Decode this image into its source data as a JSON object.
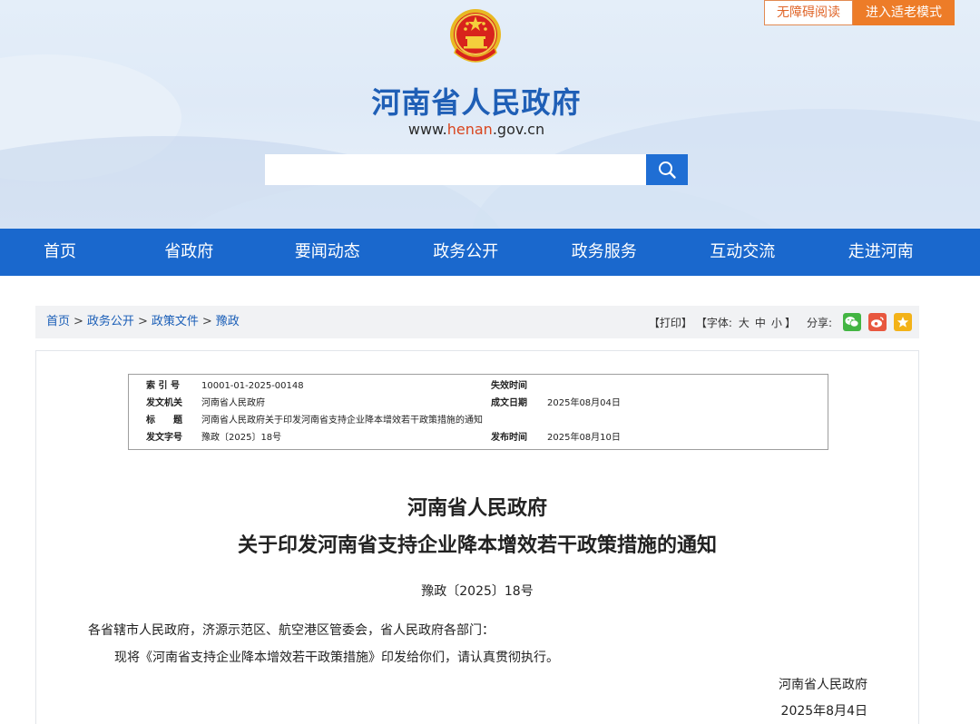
{
  "header": {
    "accessibility_label": "无障碍阅读",
    "elder_mode_label": "进入适老模式",
    "site_title": "河南省人民政府",
    "url_prefix": "www.",
    "url_highlight": "henan",
    "url_suffix": ".gov.cn",
    "search_placeholder": ""
  },
  "nav": {
    "items": [
      {
        "label": "首页"
      },
      {
        "label": "省政府"
      },
      {
        "label": "要闻动态"
      },
      {
        "label": "政务公开"
      },
      {
        "label": "政务服务"
      },
      {
        "label": "互动交流"
      },
      {
        "label": "走进河南"
      }
    ]
  },
  "breadcrumb": {
    "items": [
      "首页",
      "政务公开",
      "政策文件",
      "豫政"
    ],
    "separator": ">"
  },
  "tools": {
    "print": "【打印】",
    "font_label": "【字体:",
    "font_large": "大",
    "font_medium": "中",
    "font_small": "小",
    "font_close": "】",
    "share_label": "分享:"
  },
  "info": {
    "index_label": "索 引 号",
    "index_value": "10001-01-2025-00148",
    "expire_label": "失效时间",
    "expire_value": "",
    "issuer_label": "发文机关",
    "issuer_value": "河南省人民政府",
    "date_label": "成文日期",
    "date_value": "2025年08月04日",
    "title_label": "标　　题",
    "title_value": "河南省人民政府关于印发河南省支持企业降本增效若干政策措施的通知",
    "docno_label": "发文字号",
    "docno_value": "豫政〔2025〕18号",
    "publish_label": "发布时间",
    "publish_value": "2025年08月10日"
  },
  "document": {
    "title_line1": "河南省人民政府",
    "title_line2": "关于印发河南省支持企业降本增效若干政策措施的通知",
    "doc_number": "豫政〔2025〕18号",
    "addressee": "各省辖市人民政府，济源示范区、航空港区管委会，省人民政府各部门：",
    "body": "现将《河南省支持企业降本增效若干政策措施》印发给你们，请认真贯彻执行。",
    "signature": "河南省人民政府",
    "sign_date": "2025年8月4日"
  },
  "colors": {
    "nav_bg": "#1a68cd",
    "title_blue": "#1f5fb6",
    "orange": "#ed7c28",
    "link_blue": "#1a5eb7"
  }
}
